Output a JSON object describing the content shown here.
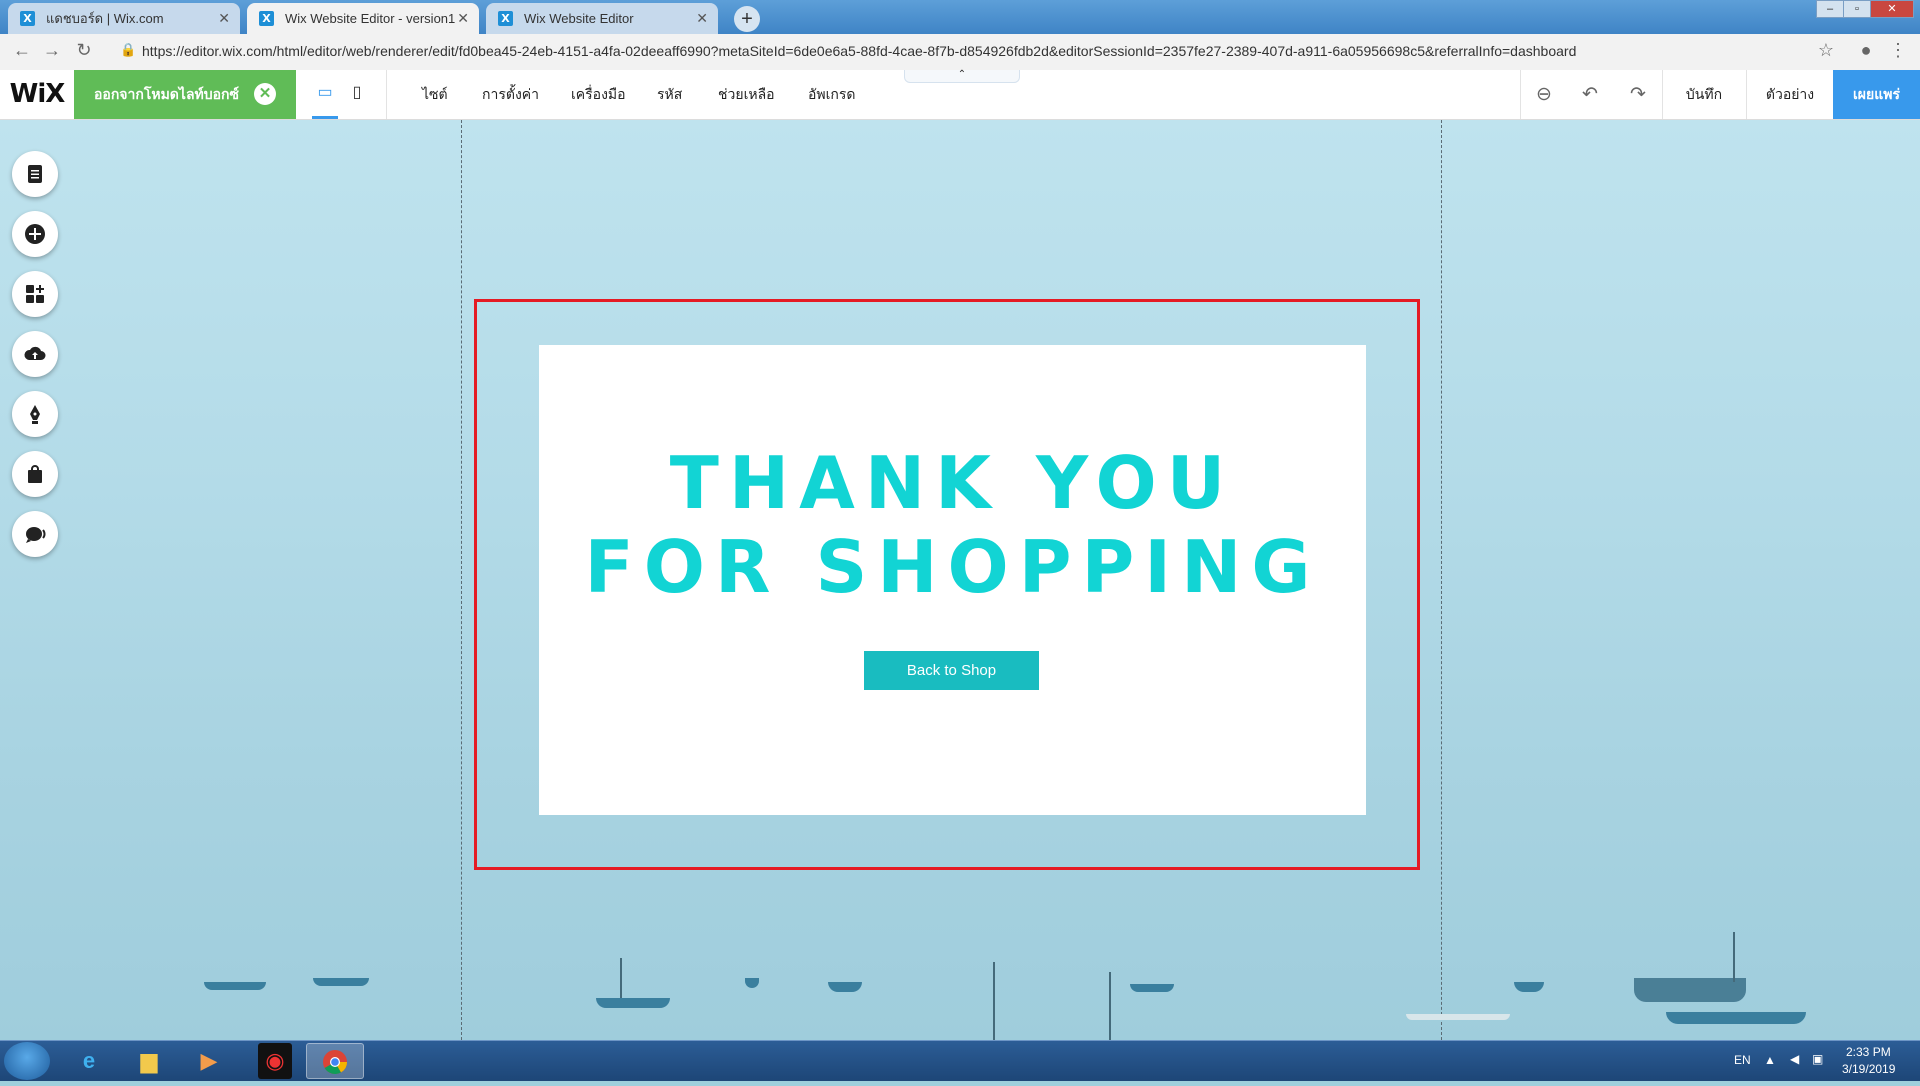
{
  "browser": {
    "tabs": [
      {
        "title": "แดชบอร์ด | Wix.com",
        "active": false
      },
      {
        "title": "Wix Website Editor - version1",
        "active": true
      },
      {
        "title": "Wix Website Editor",
        "active": false
      }
    ],
    "new_tab_symbol": "+",
    "url": "https://editor.wix.com/html/editor/web/renderer/edit/fd0bea45-24eb-4151-a4fa-02deeaff6990?metaSiteId=6de0e6a5-88fd-4cae-8f7b-d854926fdb2d&editorSessionId=2357fe27-2389-407d-a911-6a05956698c5&referralInfo=dashboard"
  },
  "editor": {
    "logo": "WiX",
    "lightbox_mode_label": "ออกจากโหมดไลท์บอกซ์",
    "menu": [
      "ไซต์",
      "การตั้งค่า",
      "เครื่องมือ",
      "รหัส",
      "ช่วยเหลือ",
      "อัพเกรด"
    ],
    "save_label": "บันทึก",
    "preview_label": "ตัวอย่าง",
    "publish_label": "เผยแพร่"
  },
  "lightbox": {
    "headline_line1": "THANK YOU",
    "headline_line2": "FOR SHOPPING",
    "button_label": "Back to Shop",
    "accent_color": "#12d4d4",
    "button_color": "#19bcc0",
    "frame_color": "#e51b24"
  },
  "sidebar_tools": [
    "pages-icon",
    "add-icon",
    "apps-icon",
    "upload-icon",
    "pen-icon",
    "store-bag-icon",
    "chat-icon"
  ],
  "taskbar": {
    "language": "EN",
    "time": "2:33 PM",
    "date": "3/19/2019"
  }
}
